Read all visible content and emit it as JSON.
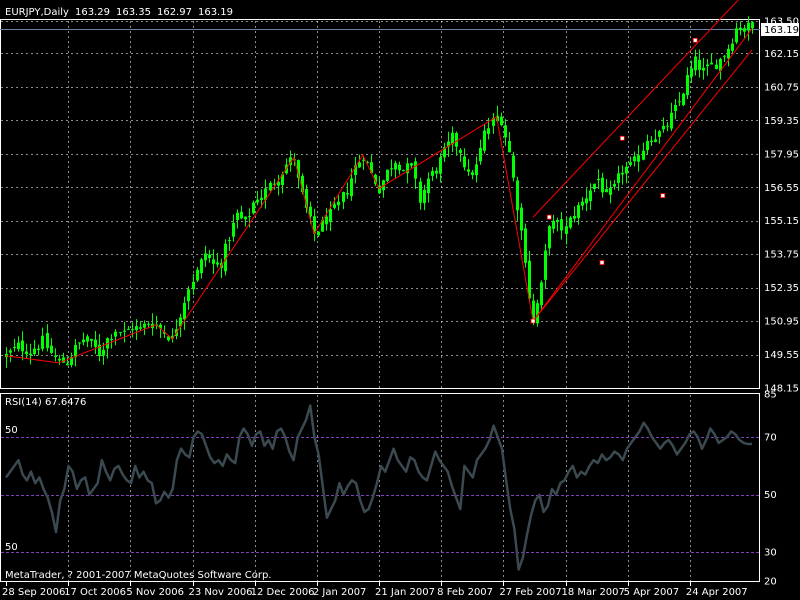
{
  "chart_data": [
    {
      "type": "candlestick",
      "header": {
        "symbol": "EURJPY",
        "timeframe": "Daily",
        "open": "163.29",
        "high": "163.35",
        "low": "162.97",
        "close": "163.19"
      },
      "current_price_label": "163.19",
      "y_ticks": [
        "163.50",
        "162.15",
        "160.75",
        "159.35",
        "157.95",
        "156.55",
        "155.15",
        "153.75",
        "152.35",
        "150.95",
        "149.55",
        "148.15"
      ],
      "ylim": [
        148.15,
        163.55
      ],
      "x_tick_labels": [
        "28 Sep 2006",
        "17 Oct 2006",
        "5 Nov 2006",
        "23 Nov 2006",
        "12 Dec 2006",
        "2 Jan 2007",
        "21 Jan 2007",
        "8 Feb 2007",
        "27 Feb 2007",
        "18 Mar 2007",
        "5 Apr 2007",
        "24 Apr 2007"
      ],
      "grid": true,
      "price_path": [
        [
          0,
          149.5
        ],
        [
          3,
          149.9
        ],
        [
          6,
          149.7
        ],
        [
          9,
          150.1
        ],
        [
          11,
          149.6
        ],
        [
          13,
          149.2
        ],
        [
          15,
          149.3
        ],
        [
          17,
          149.8
        ],
        [
          19,
          150.2
        ],
        [
          21,
          150.0
        ],
        [
          23,
          149.6
        ],
        [
          25,
          150.2
        ],
        [
          27,
          150.6
        ],
        [
          29,
          150.4
        ],
        [
          31,
          150.7
        ],
        [
          33,
          150.6
        ],
        [
          35,
          150.9
        ],
        [
          37,
          150.8
        ],
        [
          39,
          150.5
        ],
        [
          41,
          150.2
        ],
        [
          43,
          151.3
        ],
        [
          45,
          152.4
        ],
        [
          47,
          153.0
        ],
        [
          49,
          153.8
        ],
        [
          51,
          153.3
        ],
        [
          53,
          153.4
        ],
        [
          55,
          154.5
        ],
        [
          57,
          155.4
        ],
        [
          59,
          155.0
        ],
        [
          61,
          155.9
        ],
        [
          63,
          156.2
        ],
        [
          65,
          156.6
        ],
        [
          67,
          157.0
        ],
        [
          69,
          157.5
        ],
        [
          71,
          157.8
        ],
        [
          72,
          156.8
        ],
        [
          74,
          155.6
        ],
        [
          76,
          154.6
        ],
        [
          78,
          155.0
        ],
        [
          80,
          155.4
        ],
        [
          82,
          155.8
        ],
        [
          84,
          156.5
        ],
        [
          86,
          157.4
        ],
        [
          88,
          157.9
        ],
        [
          90,
          157.1
        ],
        [
          92,
          156.5
        ],
        [
          94,
          157.2
        ],
        [
          96,
          157.7
        ],
        [
          98,
          157.3
        ],
        [
          100,
          157.4
        ],
        [
          102,
          156.0
        ],
        [
          104,
          156.9
        ],
        [
          106,
          157.3
        ],
        [
          108,
          158.0
        ],
        [
          110,
          158.6
        ],
        [
          112,
          158.1
        ],
        [
          114,
          157.0
        ],
        [
          116,
          157.4
        ],
        [
          118,
          158.8
        ],
        [
          120,
          159.3
        ],
        [
          121,
          159.5
        ],
        [
          122,
          159.4
        ],
        [
          124,
          158.0
        ],
        [
          126,
          155.8
        ],
        [
          128,
          153.6
        ],
        [
          129,
          152.0
        ],
        [
          130,
          150.95
        ],
        [
          132,
          152.4
        ],
        [
          134,
          155.1
        ],
        [
          136,
          154.9
        ],
        [
          138,
          154.8
        ],
        [
          140,
          155.5
        ],
        [
          142,
          155.9
        ],
        [
          144,
          156.5
        ],
        [
          146,
          156.9
        ],
        [
          148,
          156.1
        ],
        [
          150,
          156.5
        ],
        [
          152,
          157.3
        ],
        [
          154,
          157.4
        ],
        [
          156,
          157.8
        ],
        [
          158,
          158.6
        ],
        [
          160,
          158.7
        ],
        [
          162,
          158.9
        ],
        [
          164,
          159.5
        ],
        [
          166,
          160.1
        ],
        [
          168,
          161.1
        ],
        [
          170,
          161.8
        ],
        [
          172,
          161.4
        ],
        [
          174,
          161.6
        ],
        [
          176,
          161.9
        ],
        [
          178,
          162.4
        ],
        [
          180,
          163.2
        ],
        [
          182,
          163.3
        ],
        [
          184,
          163.19
        ]
      ],
      "channel": {
        "upper": [
          [
            130,
            155.3
          ],
          [
            184,
            165.0
          ]
        ],
        "lower": [
          [
            130,
            150.95
          ],
          [
            184,
            162.3
          ]
        ],
        "pivots": [
          [
            130,
            150.95
          ],
          [
            134,
            155.3
          ],
          [
            147,
            153.4
          ],
          [
            152,
            158.6
          ],
          [
            162,
            156.2
          ],
          [
            170,
            162.7
          ]
        ]
      },
      "zigzag": [
        [
          0,
          149.5
        ],
        [
          13,
          149.2
        ],
        [
          37,
          150.8
        ],
        [
          41,
          150.2
        ],
        [
          71,
          157.8
        ],
        [
          76,
          154.6
        ],
        [
          88,
          157.9
        ],
        [
          92,
          156.5
        ],
        [
          121,
          159.5
        ],
        [
          130,
          150.95
        ],
        [
          184,
          163.19
        ]
      ],
      "color_candle": "#00ff00",
      "color_lines": "#ff0000",
      "color_grid": "#ffffff",
      "color_price_line": "#6a7fa8"
    },
    {
      "type": "line",
      "title": "RSI(14) 67.6476",
      "y_ticks_right": [
        "85",
        "70",
        "50",
        "30",
        "20"
      ],
      "y_ticks_left": [
        "50",
        "50"
      ],
      "ylim": [
        20,
        85
      ],
      "levels": [
        70,
        50,
        30
      ],
      "series": [
        {
          "values": [
            56,
            58,
            60,
            62,
            57,
            55,
            58,
            54,
            56,
            52,
            49,
            44,
            37,
            48,
            52,
            60,
            58,
            52,
            55,
            56,
            50,
            52,
            54,
            62,
            58,
            55,
            59,
            60,
            57,
            55,
            54,
            60,
            56,
            58,
            55,
            54,
            47,
            48,
            51,
            49,
            52,
            62,
            66,
            64,
            63,
            70,
            72,
            71,
            67,
            63,
            61,
            62,
            60,
            64,
            62,
            61,
            70,
            73,
            71,
            67,
            71,
            72,
            67,
            69,
            66,
            72,
            73,
            70,
            65,
            62,
            70,
            73,
            76,
            81,
            70,
            64,
            53,
            42,
            45,
            48,
            54,
            50,
            53,
            55,
            54,
            48,
            44,
            45,
            49,
            54,
            60,
            58,
            62,
            66,
            62,
            60,
            58,
            63,
            62,
            58,
            56,
            55,
            60,
            65,
            62,
            60,
            58,
            53,
            49,
            45,
            60,
            58,
            56,
            62,
            64,
            66,
            69,
            74,
            70,
            66,
            55,
            45,
            38,
            24,
            28,
            36,
            43,
            48,
            50,
            44,
            46,
            52,
            50,
            54,
            55,
            58,
            60,
            56,
            58,
            57,
            60,
            62,
            61,
            64,
            62,
            63,
            65,
            64,
            62,
            66,
            68,
            70,
            72,
            75,
            73,
            70,
            68,
            66,
            68,
            69,
            67,
            64,
            66,
            68,
            71,
            72,
            70,
            66,
            69,
            73,
            71,
            68,
            69,
            70,
            72,
            71,
            69,
            68,
            67.6,
            67.6
          ]
        }
      ],
      "color_line": "#3a4a50",
      "color_levels": "#8040c0"
    }
  ],
  "footer": {
    "copyright": "MetaTrader, ? 2001-2007 MetaQuotes Software Corp."
  }
}
